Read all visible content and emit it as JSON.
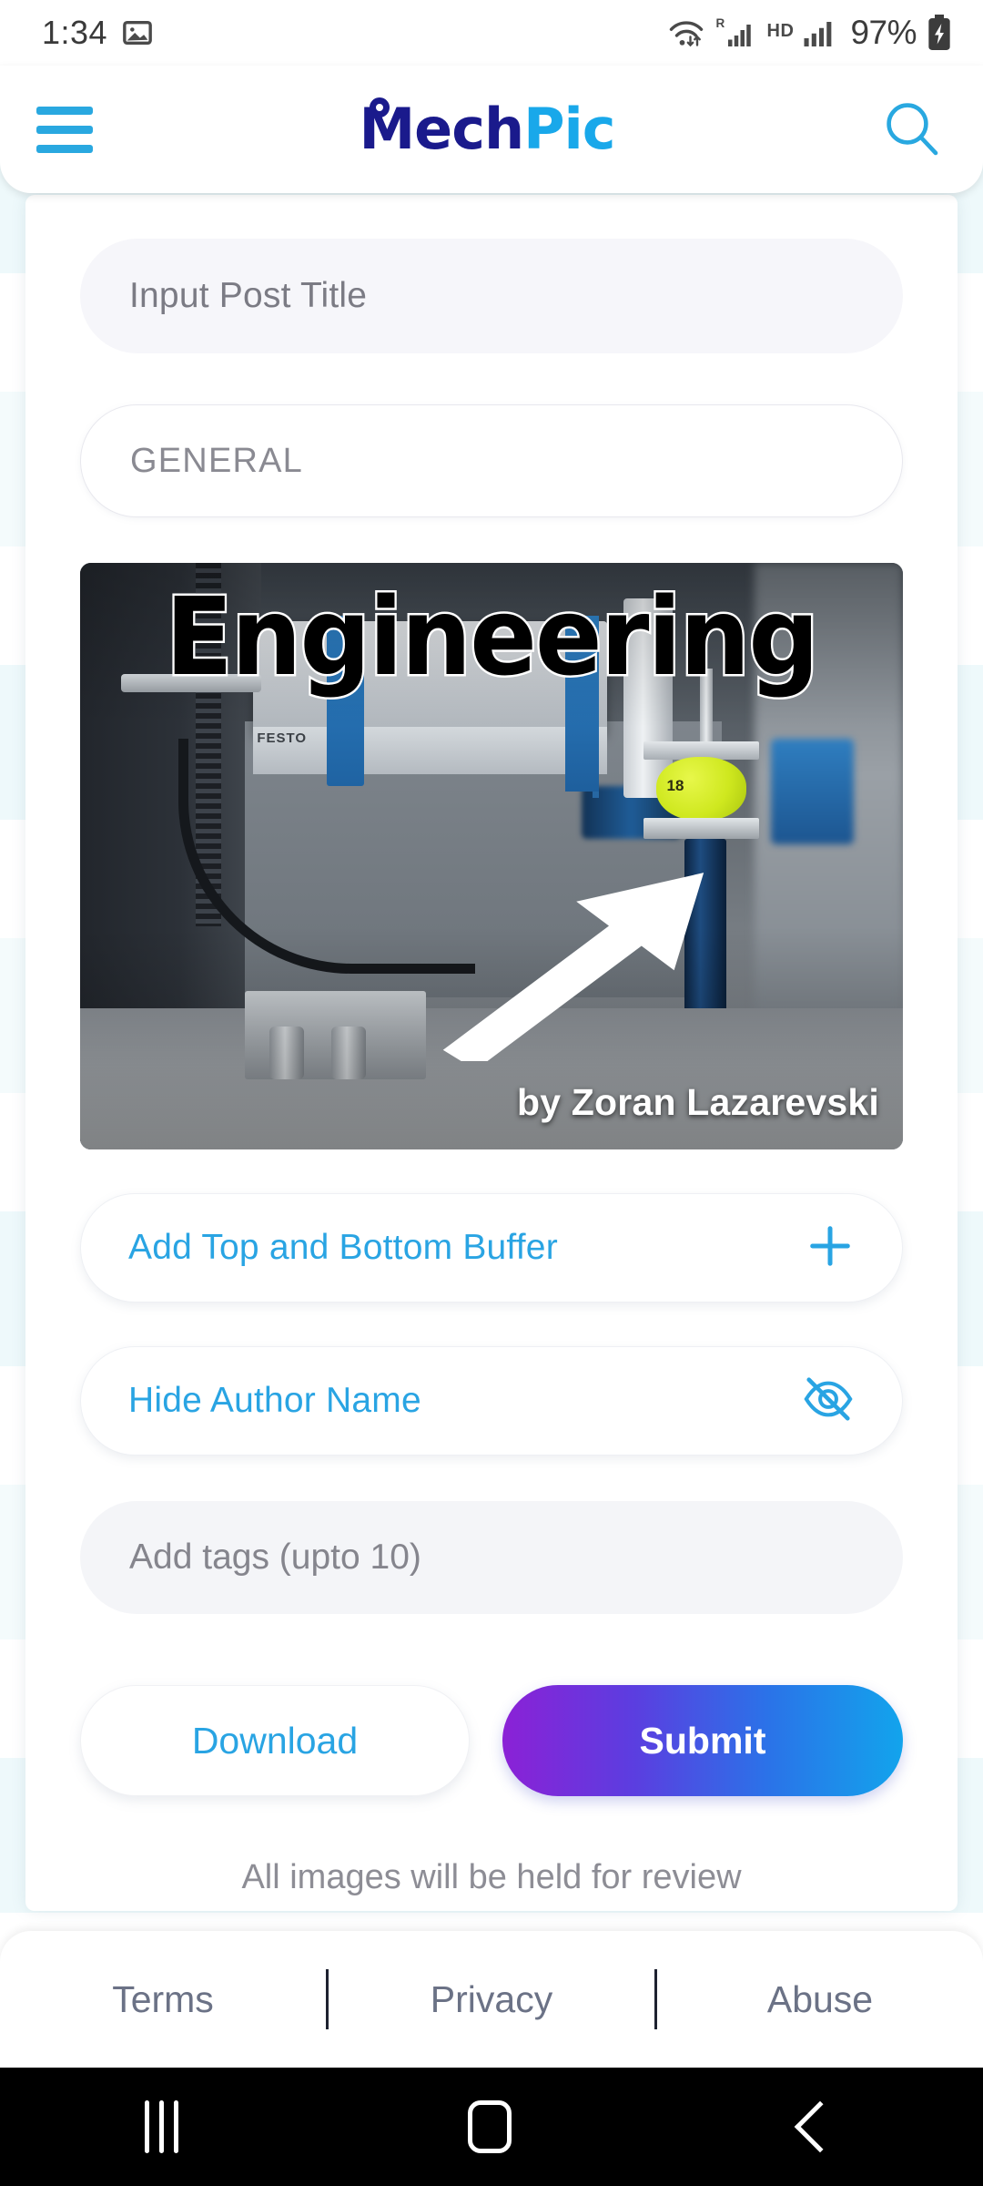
{
  "status_bar": {
    "time": "1:34",
    "gallery_icon": "image-icon",
    "wifi_icon": "wifi-icon",
    "roaming_label": "R",
    "signal_icon_1": "signal-bars-icon",
    "hd_label": "HD",
    "signal_icon_2": "signal-bars-icon",
    "battery_percent": "97%",
    "battery_icon": "battery-charging-icon"
  },
  "app_bar": {
    "menu_icon": "hamburger-menu-icon",
    "logo_primary": "Mech",
    "logo_secondary": "Pic",
    "search_icon": "search-icon"
  },
  "form": {
    "title_placeholder": "Input Post Title",
    "category_value": "GENERAL",
    "tags_placeholder": "Add tags (upto 10)"
  },
  "preview": {
    "overlay_title": "Engineering",
    "author_credit": "by Zoran Lazarevski",
    "ball_label": "18",
    "brand_label": "FESTO",
    "arrow_icon": "arrow-up-right-icon"
  },
  "options": [
    {
      "label": "Add Top and Bottom Buffer",
      "icon": "plus-icon"
    },
    {
      "label": "Hide Author Name",
      "icon": "eye-off-icon"
    }
  ],
  "actions": {
    "download_label": "Download",
    "submit_label": "Submit",
    "review_note": "All images will be held for review"
  },
  "footer": {
    "terms": "Terms",
    "privacy": "Privacy",
    "abuse": "Abuse"
  },
  "nav_bar": {
    "recents_icon": "recents-icon",
    "home_icon": "home-icon",
    "back_icon": "back-icon"
  },
  "colors": {
    "accent_blue": "#29a4e3",
    "logo_navy": "#1a1a8c",
    "submit_gradient_start": "#8b21d6",
    "submit_gradient_end": "#12a4ec",
    "background_teal": "#d9f2f5"
  }
}
